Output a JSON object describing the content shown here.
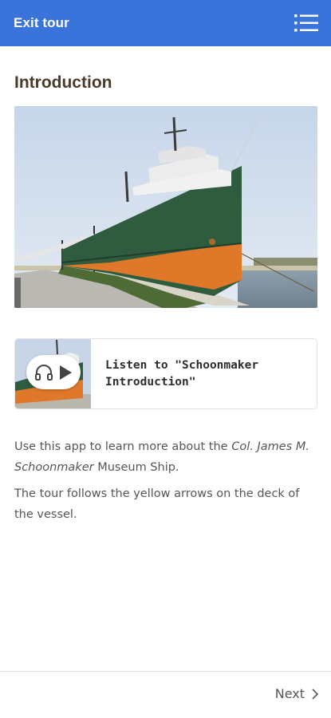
{
  "header": {
    "exit_label": "Exit tour",
    "menu_icon": "menu-list-icon",
    "bg_color": "#3a73d9"
  },
  "page": {
    "title": "Introduction"
  },
  "audio": {
    "label": "Listen to \"Schoonmaker Introduction\"",
    "icons": [
      "headphones-icon",
      "play-icon"
    ]
  },
  "body": {
    "p1_before": "Use this app to learn more about the ",
    "p1_ship": "Col. James M. Schoonmaker",
    "p1_after": " Museum Ship.",
    "p2": "The tour follows the yellow arrows on the deck of the vessel."
  },
  "footer": {
    "next_label": "Next",
    "next_icon": "chevron-right-icon"
  }
}
